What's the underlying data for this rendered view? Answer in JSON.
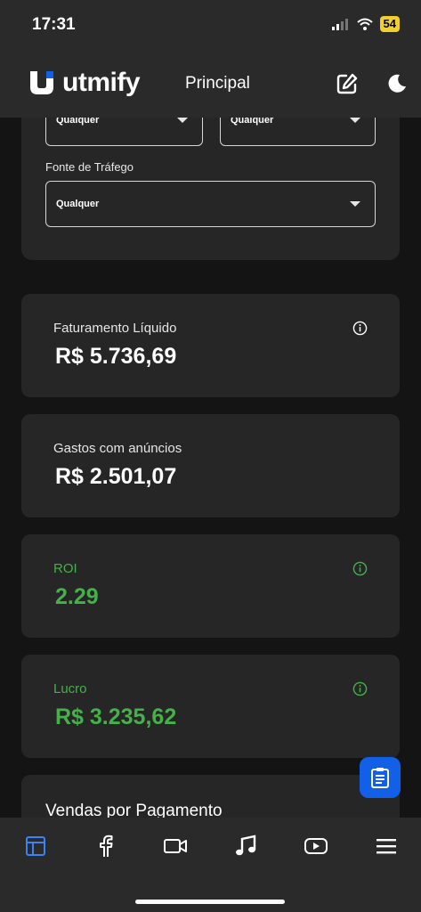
{
  "status_bar": {
    "time": "17:31",
    "battery": "54"
  },
  "header": {
    "logo_text": "utmify",
    "title": "Principal",
    "edit_icon": "edit-icon",
    "theme_icon": "moon-icon"
  },
  "filters": {
    "select_left_value": "Qualquer",
    "select_right_value": "Qualquer",
    "traffic_source_label": "Fonte de Tráfego",
    "traffic_source_value": "Qualquer"
  },
  "metrics": [
    {
      "label": "Faturamento Líquido",
      "value": "R$ 5.736,69",
      "accent": "#ffffff",
      "info": true
    },
    {
      "label": "Gastos com anúncios",
      "value": "R$ 2.501,07",
      "accent": "#ffffff",
      "info": false
    },
    {
      "label": "ROI",
      "value": "2.29",
      "accent": "#46b04a",
      "info": true
    },
    {
      "label": "Lucro",
      "value": "R$ 3.235,62",
      "accent": "#46b04a",
      "info": true
    }
  ],
  "sales_section": {
    "title": "Vendas por Pagamento"
  },
  "fab": {
    "icon": "clipboard-icon",
    "color": "#1360e8"
  },
  "bottom_nav": [
    {
      "icon": "dashboard-icon",
      "active": true
    },
    {
      "icon": "facebook-icon",
      "active": false
    },
    {
      "icon": "video-camera-icon",
      "active": false
    },
    {
      "icon": "tiktok-icon",
      "active": false
    },
    {
      "icon": "youtube-icon",
      "active": false
    },
    {
      "icon": "menu-icon",
      "active": false
    }
  ],
  "colors": {
    "background": "#141414",
    "card": "#262626",
    "bar": "#2a2a2a",
    "positive": "#46b04a",
    "active_nav": "#3b82f6"
  }
}
